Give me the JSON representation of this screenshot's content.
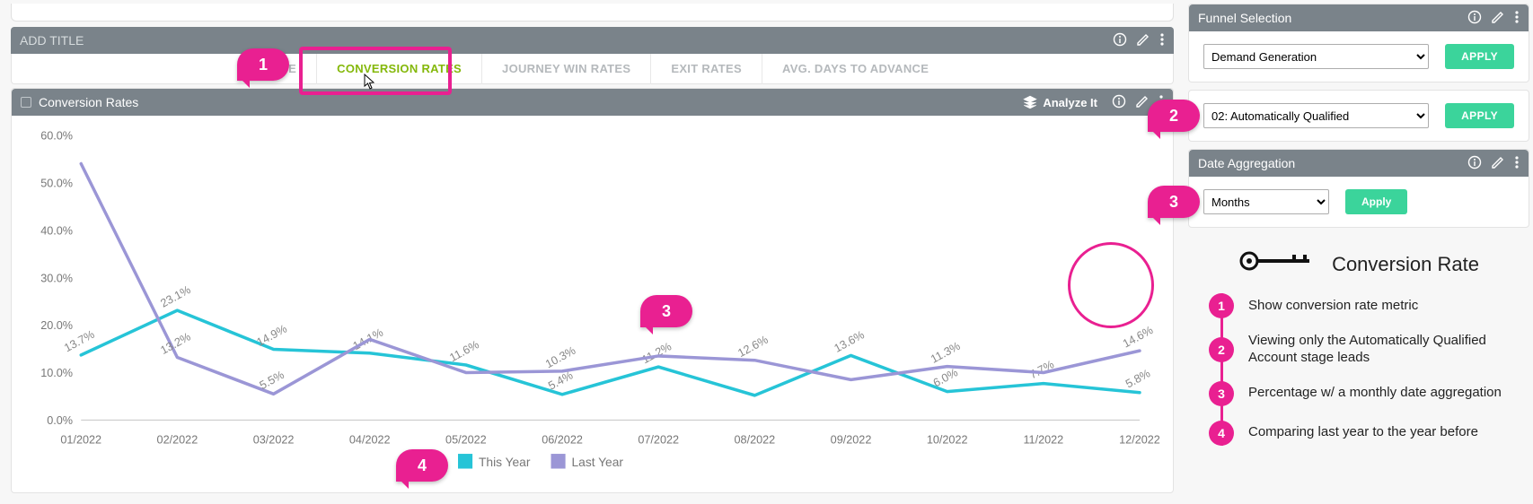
{
  "header": {
    "title_placeholder": "ADD TITLE",
    "info_icon": "info",
    "edit_icon": "pencil",
    "menu_icon": "kebab"
  },
  "tabs": [
    {
      "label": "STAGE",
      "active": false
    },
    {
      "label": "CONVERSION RATES",
      "active": true
    },
    {
      "label": "JOURNEY WIN RATES",
      "active": false
    },
    {
      "label": "EXIT RATES",
      "active": false
    },
    {
      "label": "AVG. DAYS TO ADVANCE",
      "active": false
    }
  ],
  "chart_header": {
    "title": "Conversion Rates",
    "analyze_label": "Analyze It"
  },
  "legend": {
    "series_a": "This Year",
    "series_b": "Last Year"
  },
  "colors": {
    "this_year": "#26c4d7",
    "last_year": "#9b96d6",
    "accent": "#e92091",
    "slate": "#7a838a",
    "green": "#3bd49b",
    "tab_active": "#84b80a"
  },
  "chart_data": {
    "type": "line",
    "title": "Conversion Rates",
    "xlabel": "",
    "ylabel": "",
    "ylim": [
      0,
      60
    ],
    "y_ticks": [
      "0.0%",
      "10.0%",
      "20.0%",
      "30.0%",
      "40.0%",
      "50.0%",
      "60.0%"
    ],
    "categories": [
      "01/2022",
      "02/2022",
      "03/2022",
      "04/2022",
      "05/2022",
      "06/2022",
      "07/2022",
      "08/2022",
      "09/2022",
      "10/2022",
      "11/2022",
      "12/2022"
    ],
    "series": [
      {
        "name": "This Year",
        "color": "#26c4d7",
        "values": [
          13.7,
          23.1,
          14.9,
          14.1,
          11.6,
          5.4,
          11.2,
          5.2,
          13.6,
          6.0,
          7.7,
          5.8
        ],
        "labels": [
          "13.7%",
          "23.1%",
          "14.9%",
          "14.1%",
          "11.6%",
          "5.4%",
          "11.2%",
          "",
          "13.6%",
          "6.0%",
          "7.7%",
          "5.8%"
        ]
      },
      {
        "name": "Last Year",
        "color": "#9b96d6",
        "values": [
          54.0,
          13.2,
          5.5,
          17.0,
          10.0,
          10.3,
          13.5,
          12.6,
          8.5,
          11.3,
          10.0,
          14.6
        ],
        "labels": [
          "",
          "13.2%",
          "5.5%",
          "",
          "",
          "10.3%",
          "",
          "12.6%",
          "",
          "11.3%",
          "",
          "14.6%"
        ]
      }
    ]
  },
  "side": {
    "funnel": {
      "header": "Funnel Selection",
      "select": "Demand Generation",
      "apply": "APPLY",
      "stage_select": "02: Automatically Qualified",
      "stage_apply": "APPLY"
    },
    "date_agg": {
      "header": "Date Aggregation",
      "select": "Months",
      "apply": "Apply"
    }
  },
  "key": {
    "title": "Conversion Rate",
    "items": [
      {
        "n": "1",
        "text": "Show conversion rate metric"
      },
      {
        "n": "2",
        "text": "Viewing only the Automatically Qualified Account stage leads"
      },
      {
        "n": "3",
        "text": "Percentage w/ a monthly date aggregation"
      },
      {
        "n": "4",
        "text": "Comparing last year to the year before"
      }
    ]
  },
  "annotations": {
    "a1": "1",
    "a2": "2",
    "a3": "3",
    "a4": "4",
    "a3b": "3"
  }
}
